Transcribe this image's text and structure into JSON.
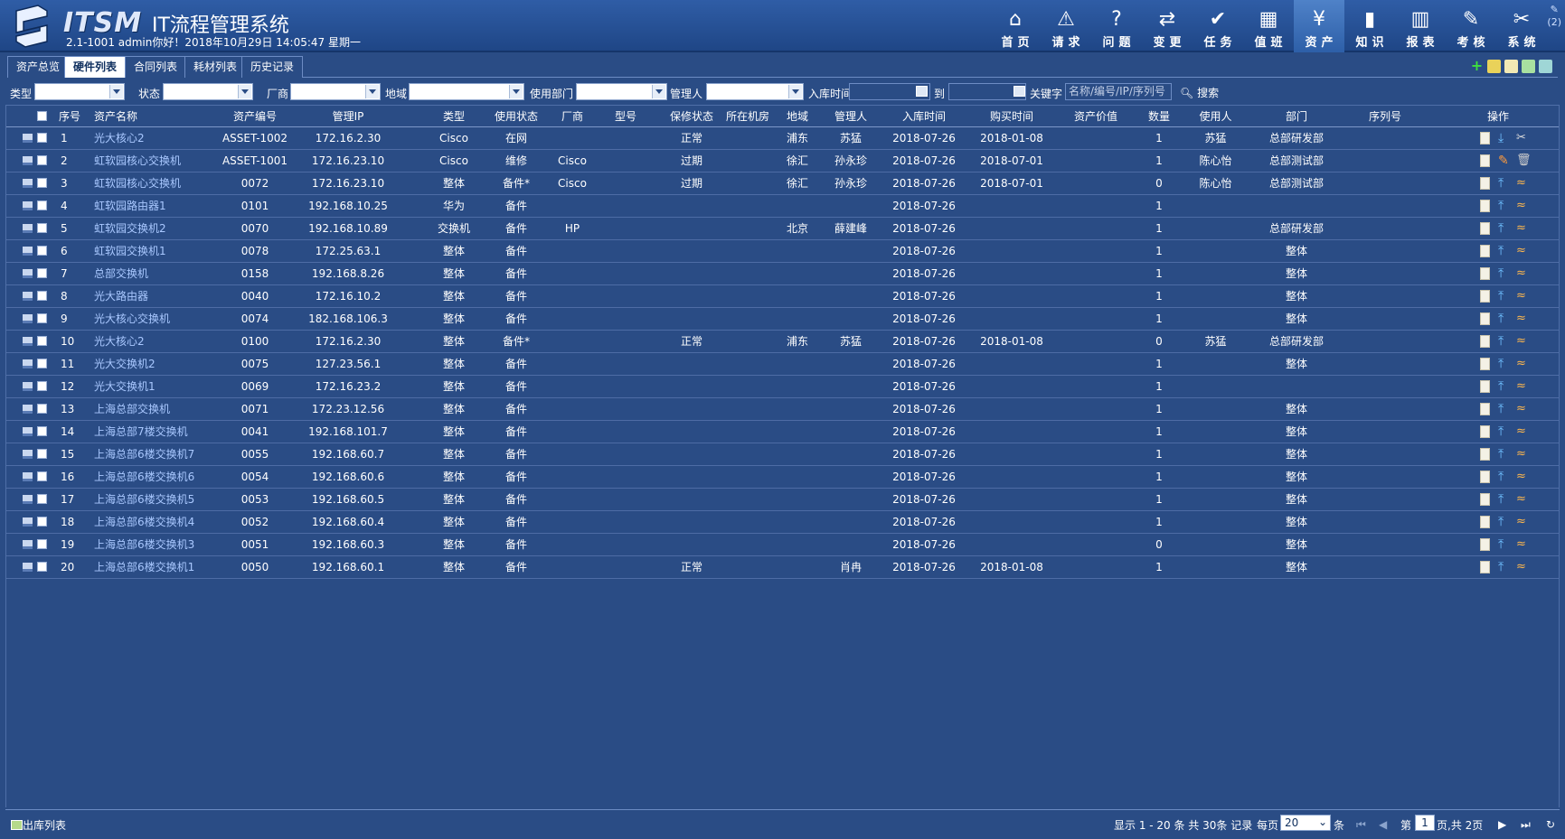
{
  "header": {
    "brand": "ITSM",
    "system_title": "IT流程管理系统",
    "user_info": "2.1-1001 admin你好！2018年10月29日 14:05:47 星期一",
    "extra": "(2)"
  },
  "nav": [
    {
      "label": "首页",
      "icon": "home-icon"
    },
    {
      "label": "请求",
      "icon": "warning-icon"
    },
    {
      "label": "问题",
      "icon": "question-icon"
    },
    {
      "label": "变更",
      "icon": "change-icon"
    },
    {
      "label": "任务",
      "icon": "task-icon"
    },
    {
      "label": "值班",
      "icon": "calendar-icon"
    },
    {
      "label": "资产",
      "icon": "asset-icon"
    },
    {
      "label": "知识",
      "icon": "book-icon"
    },
    {
      "label": "报表",
      "icon": "chart-icon"
    },
    {
      "label": "考核",
      "icon": "edit-icon"
    },
    {
      "label": "系统",
      "icon": "tools-icon"
    }
  ],
  "active_nav": "资产",
  "tabs": [
    "资产总览",
    "硬件列表",
    "合同列表",
    "耗材列表",
    "历史记录"
  ],
  "active_tab": "硬件列表",
  "filters": {
    "type": "类型",
    "status": "状态",
    "vendor": "厂商",
    "region": "地域",
    "dept": "使用部门",
    "manager": "管理人",
    "in_time": "入库时间",
    "to": "到",
    "keyword": "关键字",
    "keyword_placeholder": "名称/编号/IP/序列号",
    "search": "搜索"
  },
  "columns": [
    "序号",
    "资产名称",
    "资产编号",
    "管理IP",
    "类型",
    "使用状态",
    "厂商",
    "型号",
    "保修状态",
    "所在机房",
    "地域",
    "管理人",
    "入库时间",
    "购买时间",
    "资产价值",
    "数量",
    "使用人",
    "部门",
    "序列号",
    "操作"
  ],
  "rows": [
    {
      "no": "1",
      "name": "光大核心2",
      "code": "ASSET-1002",
      "ip": "172.16.2.30",
      "type": "Cisco",
      "status": "在网",
      "vendor": "",
      "model": "",
      "warranty": "正常",
      "room": "",
      "region": "浦东",
      "manager": "苏猛",
      "in_time": "2018-07-26",
      "buy_time": "2018-01-08",
      "value": "",
      "qty": "1",
      "user": "苏猛",
      "dept": "总部研发部",
      "serial": ""
    },
    {
      "no": "2",
      "name": "虹软园核心交换机",
      "code": "ASSET-1001",
      "ip": "172.16.23.10",
      "type": "Cisco",
      "status": "维修",
      "vendor": "Cisco",
      "model": "",
      "warranty": "过期",
      "room": "",
      "region": "徐汇",
      "manager": "孙永珍",
      "in_time": "2018-07-26",
      "buy_time": "2018-07-01",
      "value": "",
      "qty": "1",
      "user": "陈心怡",
      "dept": "总部测试部",
      "serial": ""
    },
    {
      "no": "3",
      "name": "虹软园核心交换机",
      "code": "0072",
      "ip": "172.16.23.10",
      "type": "整体",
      "status": "备件*",
      "vendor": "Cisco",
      "model": "",
      "warranty": "过期",
      "room": "",
      "region": "徐汇",
      "manager": "孙永珍",
      "in_time": "2018-07-26",
      "buy_time": "2018-07-01",
      "value": "",
      "qty": "0",
      "user": "陈心怡",
      "dept": "总部测试部",
      "serial": ""
    },
    {
      "no": "4",
      "name": "虹软园路由器1",
      "code": "0101",
      "ip": "192.168.10.25",
      "type": "华为",
      "status": "备件",
      "vendor": "",
      "model": "",
      "warranty": "",
      "room": "",
      "region": "",
      "manager": "",
      "in_time": "2018-07-26",
      "buy_time": "",
      "value": "",
      "qty": "1",
      "user": "",
      "dept": "",
      "serial": ""
    },
    {
      "no": "5",
      "name": "虹软园交换机2",
      "code": "0070",
      "ip": "192.168.10.89",
      "type": "交换机",
      "status": "备件",
      "vendor": "HP",
      "model": "",
      "warranty": "",
      "room": "",
      "region": "北京",
      "manager": "薛建峰",
      "in_time": "2018-07-26",
      "buy_time": "",
      "value": "",
      "qty": "1",
      "user": "",
      "dept": "总部研发部",
      "serial": ""
    },
    {
      "no": "6",
      "name": "虹软园交换机1",
      "code": "0078",
      "ip": "172.25.63.1",
      "type": "整体",
      "status": "备件",
      "vendor": "",
      "model": "",
      "warranty": "",
      "room": "",
      "region": "",
      "manager": "",
      "in_time": "2018-07-26",
      "buy_time": "",
      "value": "",
      "qty": "1",
      "user": "",
      "dept": "整体",
      "serial": ""
    },
    {
      "no": "7",
      "name": "总部交换机",
      "code": "0158",
      "ip": "192.168.8.26",
      "type": "整体",
      "status": "备件",
      "vendor": "",
      "model": "",
      "warranty": "",
      "room": "",
      "region": "",
      "manager": "",
      "in_time": "2018-07-26",
      "buy_time": "",
      "value": "",
      "qty": "1",
      "user": "",
      "dept": "整体",
      "serial": ""
    },
    {
      "no": "8",
      "name": "光大路由器",
      "code": "0040",
      "ip": "172.16.10.2",
      "type": "整体",
      "status": "备件",
      "vendor": "",
      "model": "",
      "warranty": "",
      "room": "",
      "region": "",
      "manager": "",
      "in_time": "2018-07-26",
      "buy_time": "",
      "value": "",
      "qty": "1",
      "user": "",
      "dept": "整体",
      "serial": ""
    },
    {
      "no": "9",
      "name": "光大核心交换机",
      "code": "0074",
      "ip": "182.168.106.3",
      "type": "整体",
      "status": "备件",
      "vendor": "",
      "model": "",
      "warranty": "",
      "room": "",
      "region": "",
      "manager": "",
      "in_time": "2018-07-26",
      "buy_time": "",
      "value": "",
      "qty": "1",
      "user": "",
      "dept": "整体",
      "serial": ""
    },
    {
      "no": "10",
      "name": "光大核心2",
      "code": "0100",
      "ip": "172.16.2.30",
      "type": "整体",
      "status": "备件*",
      "vendor": "",
      "model": "",
      "warranty": "正常",
      "room": "",
      "region": "浦东",
      "manager": "苏猛",
      "in_time": "2018-07-26",
      "buy_time": "2018-01-08",
      "value": "",
      "qty": "0",
      "user": "苏猛",
      "dept": "总部研发部",
      "serial": ""
    },
    {
      "no": "11",
      "name": "光大交换机2",
      "code": "0075",
      "ip": "127.23.56.1",
      "type": "整体",
      "status": "备件",
      "vendor": "",
      "model": "",
      "warranty": "",
      "room": "",
      "region": "",
      "manager": "",
      "in_time": "2018-07-26",
      "buy_time": "",
      "value": "",
      "qty": "1",
      "user": "",
      "dept": "整体",
      "serial": ""
    },
    {
      "no": "12",
      "name": "光大交换机1",
      "code": "0069",
      "ip": "172.16.23.2",
      "type": "整体",
      "status": "备件",
      "vendor": "",
      "model": "",
      "warranty": "",
      "room": "",
      "region": "",
      "manager": "",
      "in_time": "2018-07-26",
      "buy_time": "",
      "value": "",
      "qty": "1",
      "user": "",
      "dept": "",
      "serial": ""
    },
    {
      "no": "13",
      "name": "上海总部交换机",
      "code": "0071",
      "ip": "172.23.12.56",
      "type": "整体",
      "status": "备件",
      "vendor": "",
      "model": "",
      "warranty": "",
      "room": "",
      "region": "",
      "manager": "",
      "in_time": "2018-07-26",
      "buy_time": "",
      "value": "",
      "qty": "1",
      "user": "",
      "dept": "整体",
      "serial": ""
    },
    {
      "no": "14",
      "name": "上海总部7楼交换机",
      "code": "0041",
      "ip": "192.168.101.7",
      "type": "整体",
      "status": "备件",
      "vendor": "",
      "model": "",
      "warranty": "",
      "room": "",
      "region": "",
      "manager": "",
      "in_time": "2018-07-26",
      "buy_time": "",
      "value": "",
      "qty": "1",
      "user": "",
      "dept": "整体",
      "serial": ""
    },
    {
      "no": "15",
      "name": "上海总部6楼交换机7",
      "code": "0055",
      "ip": "192.168.60.7",
      "type": "整体",
      "status": "备件",
      "vendor": "",
      "model": "",
      "warranty": "",
      "room": "",
      "region": "",
      "manager": "",
      "in_time": "2018-07-26",
      "buy_time": "",
      "value": "",
      "qty": "1",
      "user": "",
      "dept": "整体",
      "serial": ""
    },
    {
      "no": "16",
      "name": "上海总部6楼交换机6",
      "code": "0054",
      "ip": "192.168.60.6",
      "type": "整体",
      "status": "备件",
      "vendor": "",
      "model": "",
      "warranty": "",
      "room": "",
      "region": "",
      "manager": "",
      "in_time": "2018-07-26",
      "buy_time": "",
      "value": "",
      "qty": "1",
      "user": "",
      "dept": "整体",
      "serial": ""
    },
    {
      "no": "17",
      "name": "上海总部6楼交换机5",
      "code": "0053",
      "ip": "192.168.60.5",
      "type": "整体",
      "status": "备件",
      "vendor": "",
      "model": "",
      "warranty": "",
      "room": "",
      "region": "",
      "manager": "",
      "in_time": "2018-07-26",
      "buy_time": "",
      "value": "",
      "qty": "1",
      "user": "",
      "dept": "整体",
      "serial": ""
    },
    {
      "no": "18",
      "name": "上海总部6楼交换机4",
      "code": "0052",
      "ip": "192.168.60.4",
      "type": "整体",
      "status": "备件",
      "vendor": "",
      "model": "",
      "warranty": "",
      "room": "",
      "region": "",
      "manager": "",
      "in_time": "2018-07-26",
      "buy_time": "",
      "value": "",
      "qty": "1",
      "user": "",
      "dept": "整体",
      "serial": ""
    },
    {
      "no": "19",
      "name": "上海总部6楼交换机3",
      "code": "0051",
      "ip": "192.168.60.3",
      "type": "整体",
      "status": "备件",
      "vendor": "",
      "model": "",
      "warranty": "",
      "room": "",
      "region": "",
      "manager": "",
      "in_time": "2018-07-26",
      "buy_time": "",
      "value": "",
      "qty": "0",
      "user": "",
      "dept": "整体",
      "serial": ""
    },
    {
      "no": "20",
      "name": "上海总部6楼交换机1",
      "code": "0050",
      "ip": "192.168.60.1",
      "type": "整体",
      "status": "备件",
      "vendor": "",
      "model": "",
      "warranty": "正常",
      "room": "",
      "region": "",
      "manager": "肖冉",
      "in_time": "2018-07-26",
      "buy_time": "2018-01-08",
      "value": "",
      "qty": "1",
      "user": "",
      "dept": "整体",
      "serial": ""
    }
  ],
  "footer": {
    "outbound": "出库列表",
    "summary": "显示 1 - 20 条 共 30条 记录",
    "per_page_label": "每页",
    "per_page": "20",
    "per_page_unit": "条",
    "page_prefix": "第",
    "page": "1",
    "page_suffix": "页,共 2页"
  },
  "colors": {
    "bg": "#2a4c85",
    "header": "#1f4686",
    "link": "#a9c8ff"
  }
}
